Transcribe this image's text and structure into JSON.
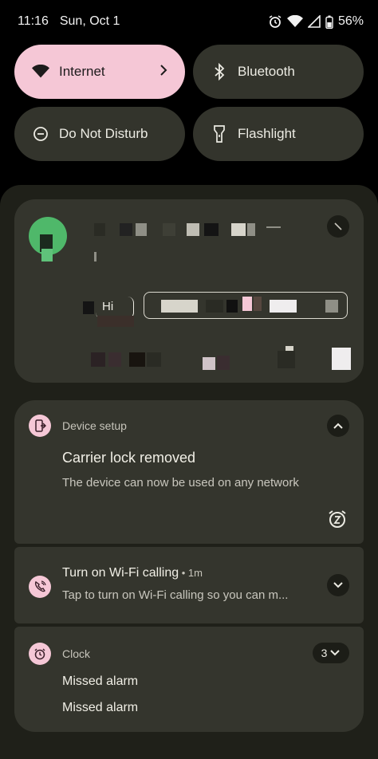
{
  "status_bar": {
    "time": "11:16",
    "date": "Sun, Oct 1",
    "battery": "56%",
    "icons": [
      "alarm-icon",
      "wifi-icon",
      "signal-icon",
      "battery-icon"
    ]
  },
  "quick_settings": {
    "tiles": [
      {
        "label": "Internet",
        "icon": "wifi-icon",
        "active": true
      },
      {
        "label": "Bluetooth",
        "icon": "bluetooth-icon",
        "active": false
      },
      {
        "label": "Do Not Disturb",
        "icon": "dnd-icon",
        "active": false
      },
      {
        "label": "Flashlight",
        "icon": "flashlight-icon",
        "active": false
      }
    ]
  },
  "notifications": {
    "media_reply_label": "Hi",
    "device_setup": {
      "app": "Device setup",
      "title": "Carrier lock removed",
      "body": "The device can now be used on any network"
    },
    "wifi_calling": {
      "title": "Turn on Wi-Fi calling",
      "time": " • 1m",
      "body": "Tap to turn on Wi-Fi calling so you can m..."
    },
    "clock": {
      "app": "Clock",
      "count": "3",
      "items": [
        "Missed alarm",
        "Missed alarm"
      ]
    }
  },
  "colors": {
    "accent_pink": "#f5c7d6",
    "tile_bg": "#33342c",
    "card_bg": "#34352d",
    "shade_bg": "#1f2019"
  }
}
